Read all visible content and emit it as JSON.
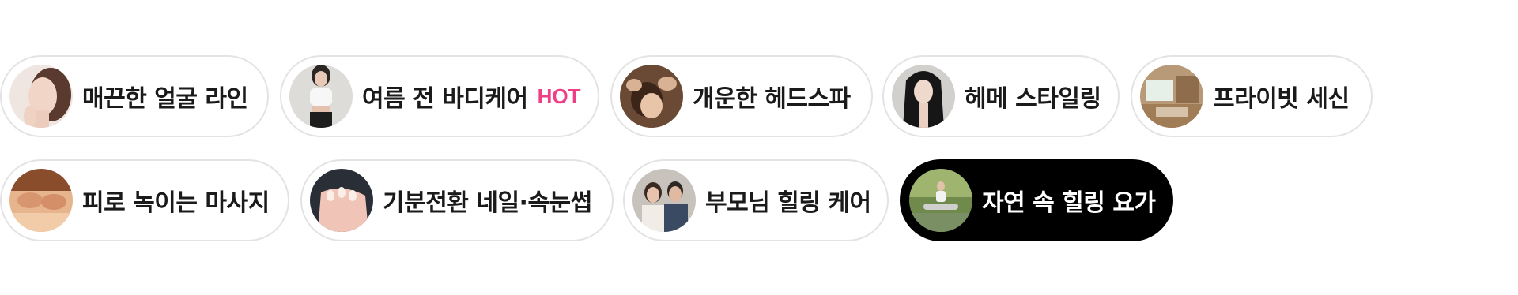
{
  "categories": [
    {
      "label": "매끈한 얼굴 라인",
      "badge": "",
      "active": false,
      "image": "face-portrait"
    },
    {
      "label": "여름 전 바디케어",
      "badge": "HOT",
      "active": false,
      "image": "body-care"
    },
    {
      "label": "개운한 헤드스파",
      "badge": "",
      "active": false,
      "image": "head-spa"
    },
    {
      "label": "헤메 스타일링",
      "badge": "",
      "active": false,
      "image": "hair-styling"
    },
    {
      "label": "프라이빗 세신",
      "badge": "",
      "active": false,
      "image": "private-room"
    },
    {
      "label": "피로 녹이는 마사지",
      "badge": "",
      "active": false,
      "image": "massage"
    },
    {
      "label": "기분전환 네일·속눈썹",
      "badge": "",
      "active": false,
      "image": "nail"
    },
    {
      "label": "부모님 힐링 케어",
      "badge": "",
      "active": false,
      "image": "parents"
    },
    {
      "label": "자연 속 힐링 요가",
      "badge": "",
      "active": true,
      "image": "yoga"
    }
  ],
  "colors": {
    "badge": "#ee3e86",
    "chip_border": "#e3e3e6",
    "active_bg": "#000000",
    "active_text": "#ffffff",
    "text": "#1a1a1a"
  }
}
